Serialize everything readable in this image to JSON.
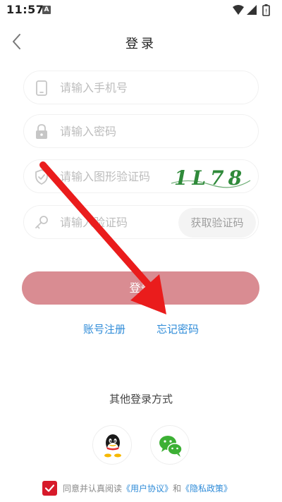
{
  "status": {
    "time": "11:57",
    "notif_letter": "A"
  },
  "nav": {
    "title": "登录"
  },
  "form": {
    "phone_placeholder": "请输入手机号",
    "password_placeholder": "请输入密码",
    "captcha_placeholder": "请输入图形验证码",
    "captcha_text": "1L78",
    "sms_placeholder": "请输入验证码",
    "get_code_label": "获取验证码"
  },
  "login_button": "登录",
  "links": {
    "register": "账号注册",
    "forgot": "忘记密码"
  },
  "other_login": {
    "title": "其他登录方式"
  },
  "agreement": {
    "prefix": "同意并认真阅读",
    "user_agreement": "《用户协议》",
    "and": "和",
    "privacy_policy": "《隐私政策》",
    "checked": true
  },
  "colors": {
    "accent": "#2e8bd8",
    "login_button": "#d98c92",
    "checkbox": "#d71a2a",
    "arrow": "#ea1c1c",
    "captcha": "#2f8a3a"
  }
}
